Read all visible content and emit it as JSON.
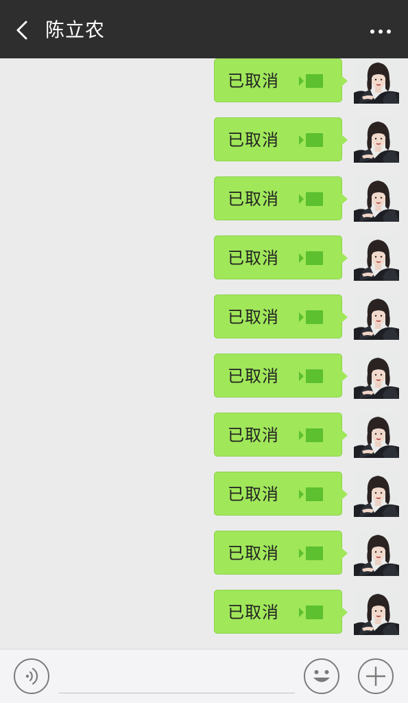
{
  "header": {
    "title": "陈立农",
    "back_icon": "chevron-left-icon",
    "more_icon": "more-dots-icon"
  },
  "messages": [
    {
      "text": "已取消",
      "type": "video-call",
      "icon": "video-call-icon"
    },
    {
      "text": "已取消",
      "type": "video-call",
      "icon": "video-call-icon"
    },
    {
      "text": "已取消",
      "type": "video-call",
      "icon": "video-call-icon"
    },
    {
      "text": "已取消",
      "type": "video-call",
      "icon": "video-call-icon"
    },
    {
      "text": "已取消",
      "type": "video-call",
      "icon": "video-call-icon"
    },
    {
      "text": "已取消",
      "type": "video-call",
      "icon": "video-call-icon"
    },
    {
      "text": "已取消",
      "type": "video-call",
      "icon": "video-call-icon"
    },
    {
      "text": "已取消",
      "type": "video-call",
      "icon": "video-call-icon"
    },
    {
      "text": "已取消",
      "type": "video-call",
      "icon": "video-call-icon"
    },
    {
      "text": "已取消",
      "type": "video-call",
      "icon": "video-call-icon"
    }
  ],
  "input_bar": {
    "voice_icon": "voice-icon",
    "emoji_icon": "emoji-icon",
    "plus_icon": "plus-icon",
    "input_value": ""
  },
  "colors": {
    "header_bg": "#2e2e2e",
    "chat_bg": "#ebebeb",
    "bubble_bg": "#a0e75a",
    "video_icon": "#5cc02f"
  }
}
